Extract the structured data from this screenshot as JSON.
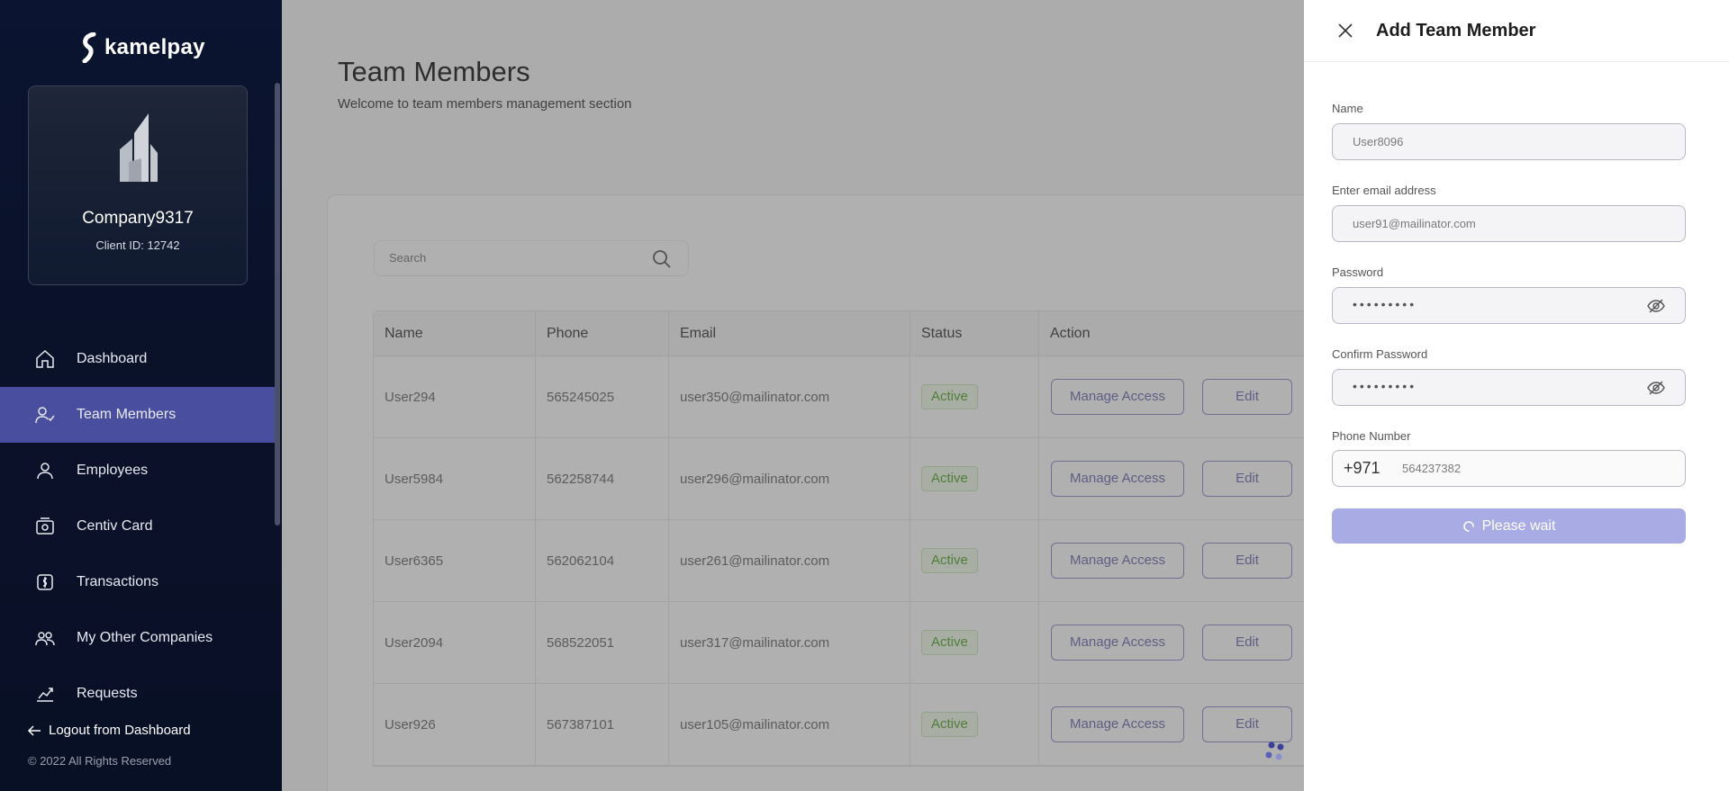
{
  "brand": {
    "name": "kamelpay"
  },
  "company": {
    "name": "Company9317",
    "client_id": "Client ID: 12742"
  },
  "nav": [
    {
      "label": "Dashboard",
      "icon": "home-icon",
      "active": false
    },
    {
      "label": "Team Members",
      "icon": "user-check-icon",
      "active": true
    },
    {
      "label": "Employees",
      "icon": "user-icon",
      "active": false
    },
    {
      "label": "Centiv Card",
      "icon": "card-icon",
      "active": false
    },
    {
      "label": "Transactions",
      "icon": "transactions-icon",
      "active": false
    },
    {
      "label": "My Other Companies",
      "icon": "users-icon",
      "active": false
    },
    {
      "label": "Requests",
      "icon": "requests-icon",
      "active": false
    }
  ],
  "logout_label": "Logout from Dashboard",
  "copyright": "© 2022 All Rights Reserved",
  "page": {
    "title": "Team Members",
    "subtitle": "Welcome to team members management section",
    "search_placeholder": "Search"
  },
  "table": {
    "headers": [
      "Name",
      "Phone",
      "Email",
      "Status",
      "Action"
    ],
    "rows": [
      {
        "name": "User294",
        "phone": "565245025",
        "email": "user350@mailinator.com",
        "status": "Active",
        "manage": "Manage Access",
        "edit": "Edit"
      },
      {
        "name": "User5984",
        "phone": "562258744",
        "email": "user296@mailinator.com",
        "status": "Active",
        "manage": "Manage Access",
        "edit": "Edit"
      },
      {
        "name": "User6365",
        "phone": "562062104",
        "email": "user261@mailinator.com",
        "status": "Active",
        "manage": "Manage Access",
        "edit": "Edit"
      },
      {
        "name": "User2094",
        "phone": "568522051",
        "email": "user317@mailinator.com",
        "status": "Active",
        "manage": "Manage Access",
        "edit": "Edit"
      },
      {
        "name": "User926",
        "phone": "567387101",
        "email": "user105@mailinator.com",
        "status": "Active",
        "manage": "Manage Access",
        "edit": "Edit"
      }
    ]
  },
  "drawer": {
    "title": "Add Team Member",
    "name_label": "Name",
    "name_value": "User8096",
    "email_label": "Enter email address",
    "email_value": "user91@mailinator.com",
    "password_label": "Password",
    "password_mask": "•••••••••",
    "confirm_label": "Confirm Password",
    "confirm_mask": "•••••••••",
    "phone_label": "Phone Number",
    "dial_code": "+971",
    "phone_value": "564237382",
    "submit_label": "Please wait"
  },
  "colors": {
    "sidebar_bg": "#0b1430",
    "nav_active": "#4a4e9e",
    "submit_bg": "#a8abe4",
    "status_green": "#4fa52a"
  }
}
